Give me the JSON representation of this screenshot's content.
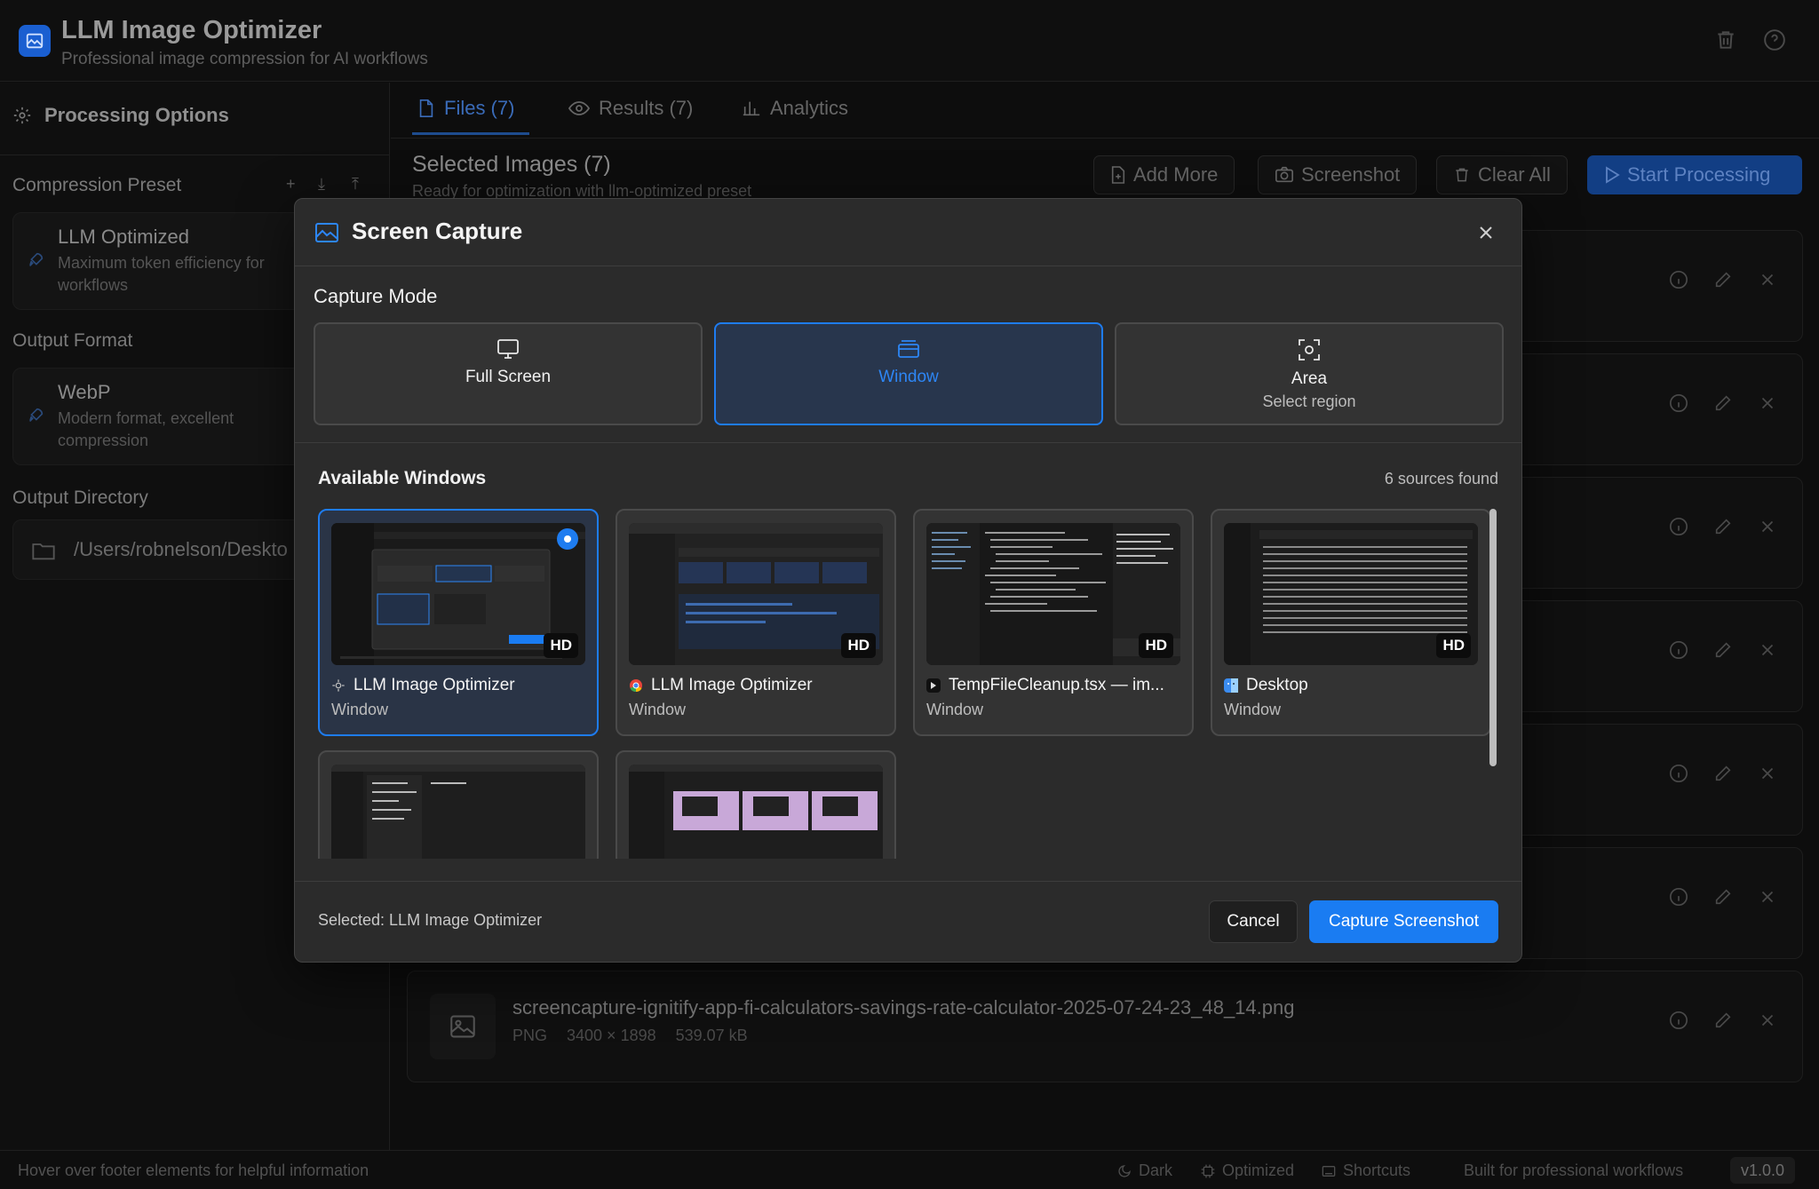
{
  "app": {
    "title": "LLM Image Optimizer",
    "subtitle": "Professional image compression for AI workflows"
  },
  "sidebar": {
    "title": "Processing Options",
    "compression": {
      "label": "Compression Preset",
      "preset_name": "LLM Optimized",
      "preset_desc": "Maximum token efficiency for workflows",
      "tools": [
        "+",
        "⤓",
        "⤒"
      ]
    },
    "output_format": {
      "label": "Output Format",
      "name": "WebP",
      "desc": "Modern format, excellent compression"
    },
    "output_directory": {
      "label": "Output Directory",
      "path": "/Users/robnelson/Deskto"
    }
  },
  "main": {
    "tabs": [
      {
        "label": "Files (7)"
      },
      {
        "label": "Results (7)"
      },
      {
        "label": "Analytics"
      }
    ],
    "selected_title": "Selected Images (7)",
    "selected_subtitle": "Ready for optimization with llm-optimized preset",
    "toolbar": {
      "add_more": "Add More",
      "screenshot": "Screenshot",
      "clear_all": "Clear All",
      "start": "Start Processing"
    },
    "last_file": {
      "name": "screencapture-ignitify-app-fi-calculators-savings-rate-calculator-2025-07-24-23_48_14.png",
      "format": "PNG",
      "dimensions": "3400 × 1898",
      "size": "539.07 kB"
    }
  },
  "footer": {
    "hint": "Hover over footer elements for helpful information",
    "theme": "Dark",
    "status": "Optimized",
    "shortcuts": "Shortcuts",
    "tagline": "Built for professional workflows",
    "version": "v1.0.0"
  },
  "modal": {
    "title": "Screen Capture",
    "capture_mode_label": "Capture Mode",
    "modes": [
      {
        "label": "Full Screen",
        "sub": "",
        "icon": "monitor-icon"
      },
      {
        "label": "Window",
        "sub": "",
        "icon": "window-icon"
      },
      {
        "label": "Area",
        "sub": "Select region",
        "icon": "crop-area-icon"
      }
    ],
    "selected_mode": "Window",
    "available_label": "Available Windows",
    "sources_count": "6 sources found",
    "windows": [
      {
        "title": "LLM Image Optimizer",
        "type": "Window",
        "badge": "HD",
        "selected": true,
        "app_icon": "gear-app-icon"
      },
      {
        "title": "LLM Image Optimizer",
        "type": "Window",
        "badge": "HD",
        "selected": false,
        "app_icon": "chrome-icon"
      },
      {
        "title": "TempFileCleanup.tsx — im...",
        "type": "Window",
        "badge": "HD",
        "selected": false,
        "app_icon": "cursor-editor-icon"
      },
      {
        "title": "Desktop",
        "type": "Window",
        "badge": "HD",
        "selected": false,
        "app_icon": "finder-icon"
      },
      {
        "title": "",
        "type": "",
        "badge": "",
        "selected": false,
        "app_icon": ""
      },
      {
        "title": "",
        "type": "",
        "badge": "",
        "selected": false,
        "app_icon": ""
      }
    ],
    "selected_text": "Selected: LLM Image Optimizer",
    "cancel": "Cancel",
    "capture": "Capture Screenshot"
  },
  "colors": {
    "accent": "#1e7cf0",
    "modal_bg": "#2b2b2b",
    "app_bg": "#0d0d0d"
  }
}
